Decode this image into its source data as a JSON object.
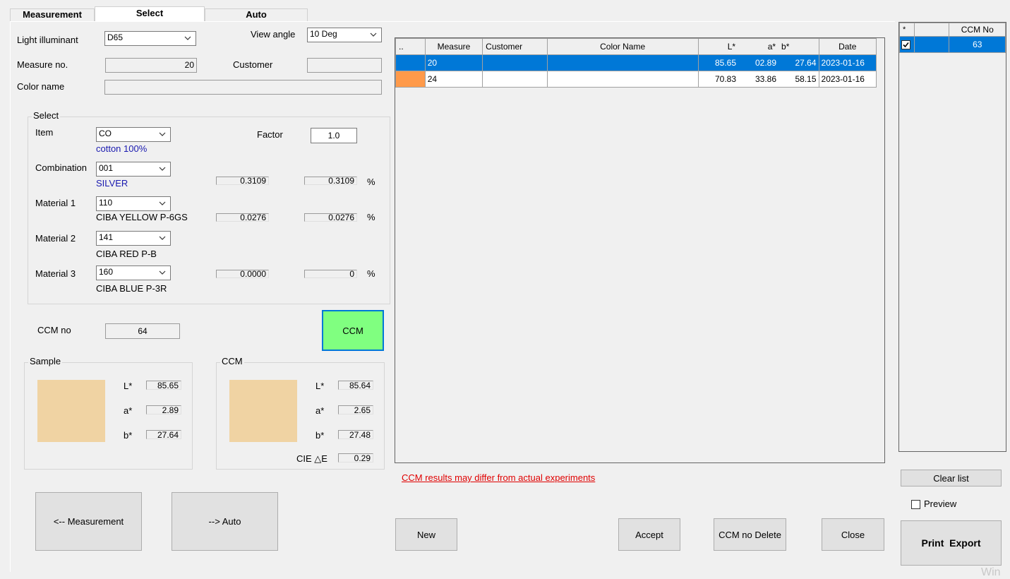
{
  "tabs": [
    "Measurement",
    "Select",
    "Auto"
  ],
  "form": {
    "light_illuminant_label": "Light illuminant",
    "light_illuminant_value": "D65",
    "view_angle_label": "View angle",
    "view_angle_value": "10 Deg",
    "measure_no_label": "Measure no.",
    "measure_no_value": "20",
    "customer_label": "Customer",
    "customer_value": "",
    "color_name_label": "Color name",
    "color_name_value": ""
  },
  "select_group": {
    "title": "Select",
    "item_label": "Item",
    "item_value": "CO",
    "item_desc": "cotton 100%",
    "factor_label": "Factor",
    "factor_value": "1.0",
    "combination_label": "Combination",
    "combination_value": "001",
    "combination_desc": "SILVER",
    "combination_v1": "0.3109",
    "combination_v2": "0.3109",
    "materials": [
      {
        "label": "Material 1",
        "value": "110",
        "desc": "CIBA YELLOW P-6GS",
        "v1": "0.0276",
        "v2": "0.0276",
        "pct": "%"
      },
      {
        "label": "Material 2",
        "value": "141",
        "desc": "CIBA RED P-B",
        "v1": "",
        "v2": "",
        "pct": ""
      },
      {
        "label": "Material 3",
        "value": "160",
        "desc": "CIBA BLUE P-3R",
        "v1": "0.0000",
        "v2": "0",
        "pct": "%"
      }
    ],
    "pct": "%"
  },
  "ccm": {
    "ccm_no_label": "CCM no",
    "ccm_no_value": "64",
    "ccm_button": "CCM"
  },
  "sample": {
    "title": "Sample",
    "color": "#f0d3a3",
    "l_label": "L*",
    "a_label": "a*",
    "b_label": "b*",
    "l": "85.65",
    "a": "2.89",
    "b": "27.64"
  },
  "ccm_result": {
    "title": "CCM",
    "color": "#f0d3a3",
    "l_label": "L*",
    "a_label": "a*",
    "b_label": "b*",
    "de_label": "CIE △E",
    "l": "85.64",
    "a": "2.65",
    "b": "27.48",
    "de": "0.29"
  },
  "nav_buttons": {
    "measurement": "<-- Measurement",
    "auto": "--> Auto"
  },
  "table": {
    "headers": [
      "..",
      "Measure",
      "Customer",
      "Color Name",
      "L*",
      "a*",
      "b*",
      "Date"
    ],
    "rows": [
      {
        "color": "#0078d7",
        "measure": "20",
        "customer": "",
        "color_name": "",
        "l": "85.65",
        "a": "02.89",
        "b": "27.64",
        "date": "2023-01-16",
        "selected": true
      },
      {
        "color": "#ff9a4a",
        "measure": "24",
        "customer": "",
        "color_name": "",
        "l": "70.83",
        "a": "33.86",
        "b": "58.15",
        "date": "2023-01-16",
        "selected": false
      }
    ]
  },
  "warning": "CCM results may differ from actual experiments",
  "actions": {
    "new": "New",
    "accept": "Accept",
    "ccm_no_delete": "CCM no Delete",
    "close": "Close"
  },
  "ccm_list": {
    "headers": [
      "*",
      "",
      "CCM No"
    ],
    "rows": [
      {
        "checked": true,
        "ccm_no": "63"
      }
    ]
  },
  "right_panel": {
    "clear_list": "Clear list",
    "preview_label": "Preview",
    "preview_checked": false,
    "print_export": "Print  Export"
  },
  "watermark": "Win"
}
